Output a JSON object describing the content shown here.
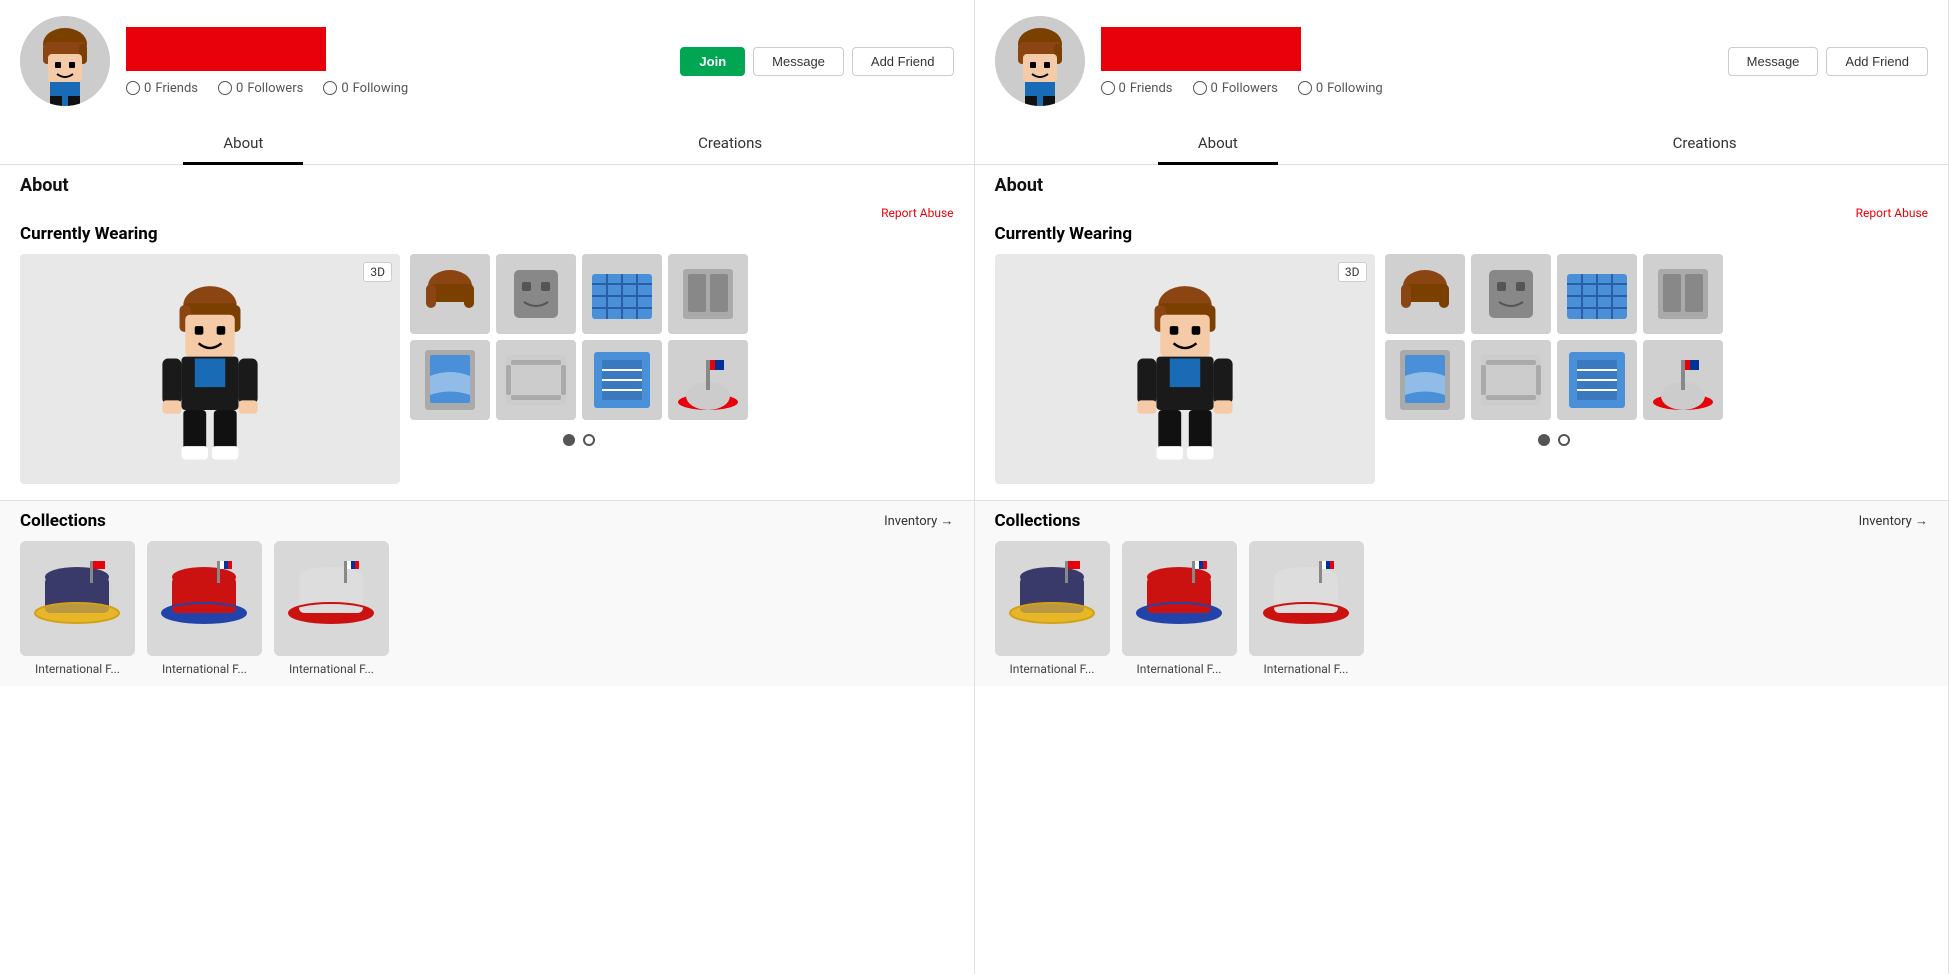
{
  "panels": [
    {
      "id": "panel-left",
      "header": {
        "avatar_alt": "Roblox avatar",
        "username_bar_color": "#e8000b",
        "stats": [
          {
            "label": "Friends",
            "value": "0"
          },
          {
            "label": "Followers",
            "value": "0"
          },
          {
            "label": "Following",
            "value": "0"
          }
        ],
        "actions": [
          {
            "label": "Join",
            "type": "join"
          },
          {
            "label": "Message",
            "type": "secondary"
          },
          {
            "label": "Add Friend",
            "type": "secondary"
          }
        ]
      },
      "tabs": [
        {
          "label": "About",
          "active": true
        },
        {
          "label": "Creations",
          "active": false
        }
      ],
      "about_title": "About",
      "report_abuse": "Report Abuse",
      "wearing_title": "Currently Wearing",
      "wearing_3d_label": "3D",
      "carousel_dots": [
        {
          "filled": true
        },
        {
          "filled": false
        }
      ],
      "collections_title": "Collections",
      "inventory_label": "Inventory →",
      "collection_items": [
        {
          "label": "International F..."
        },
        {
          "label": "International F..."
        },
        {
          "label": "International F..."
        }
      ]
    },
    {
      "id": "panel-right",
      "header": {
        "avatar_alt": "Roblox avatar",
        "username_bar_color": "#e8000b",
        "stats": [
          {
            "label": "Friends",
            "value": "0"
          },
          {
            "label": "Followers",
            "value": "0"
          },
          {
            "label": "Following",
            "value": "0"
          }
        ],
        "actions": [
          {
            "label": "Message",
            "type": "secondary"
          },
          {
            "label": "Add Friend",
            "type": "secondary"
          }
        ]
      },
      "tabs": [
        {
          "label": "About",
          "active": true
        },
        {
          "label": "Creations",
          "active": false
        }
      ],
      "about_title": "About",
      "report_abuse": "Report Abuse",
      "wearing_title": "Currently Wearing",
      "wearing_3d_label": "3D",
      "carousel_dots": [
        {
          "filled": true
        },
        {
          "filled": false
        }
      ],
      "collections_title": "Collections",
      "inventory_label": "Inventory →",
      "collection_items": [
        {
          "label": "International F..."
        },
        {
          "label": "International F..."
        },
        {
          "label": "International F..."
        }
      ]
    }
  ]
}
